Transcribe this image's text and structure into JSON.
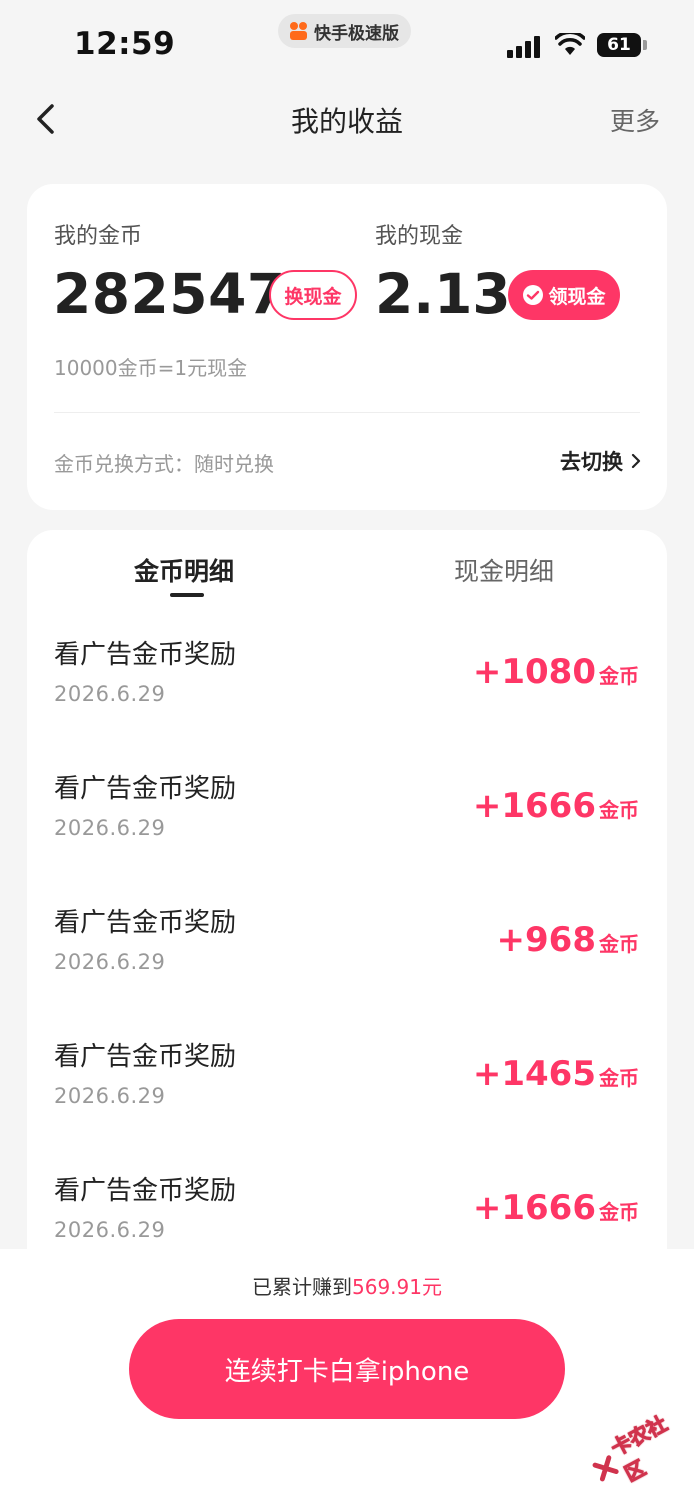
{
  "status_bar": {
    "time": "12:59",
    "app_name": "快手极速版",
    "battery": "61"
  },
  "nav": {
    "title": "我的收益",
    "more": "更多"
  },
  "earnings": {
    "coin_label": "我的金币",
    "coin_value": "282547",
    "exchange_button": "换现金",
    "cash_label": "我的现金",
    "cash_value": "2.13",
    "withdraw_button": "领现金",
    "rate": "10000金币=1元现金",
    "method": "金币兑换方式：随时兑换",
    "switch_link": "去切换"
  },
  "tabs": [
    {
      "label": "金币明细",
      "active": true
    },
    {
      "label": "现金明细",
      "active": false
    }
  ],
  "records": [
    {
      "title": "看广告金币奖励",
      "date": "2026.6.29",
      "amount": "+1080",
      "unit": "金币"
    },
    {
      "title": "看广告金币奖励",
      "date": "2026.6.29",
      "amount": "+1666",
      "unit": "金币"
    },
    {
      "title": "看广告金币奖励",
      "date": "2026.6.29",
      "amount": "+968",
      "unit": "金币"
    },
    {
      "title": "看广告金币奖励",
      "date": "2026.6.29",
      "amount": "+1465",
      "unit": "金币"
    },
    {
      "title": "看广告金币奖励",
      "date": "2026.6.29",
      "amount": "+1666",
      "unit": "金币"
    }
  ],
  "footer": {
    "total_prefix": "已累计赚到",
    "total_amount": "569.91元",
    "checkin_button": "连续打卡白拿iphone"
  },
  "watermark": {
    "text": "卡农社区"
  },
  "colors": {
    "accent": "#fe3666",
    "background": "#f5f5f5"
  }
}
